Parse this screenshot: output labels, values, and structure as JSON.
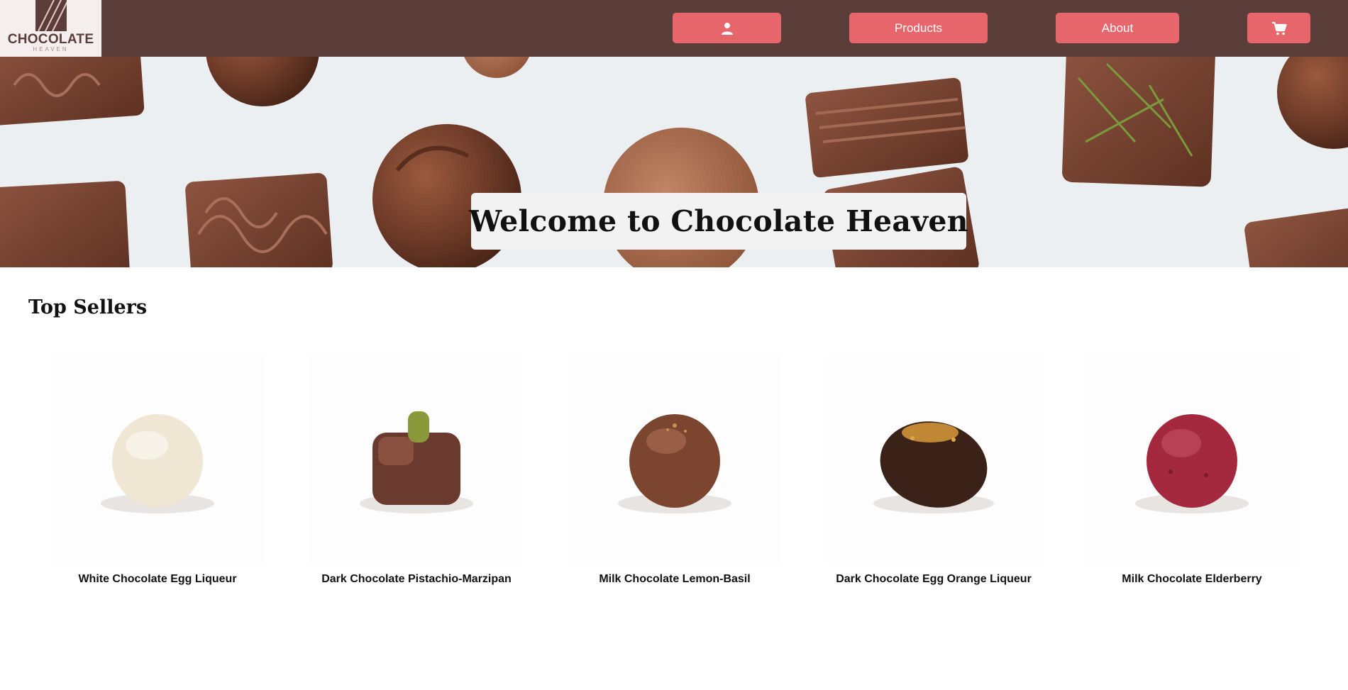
{
  "header": {
    "logo": {
      "main": "CHOCOLATE",
      "sub": "HEAVEN"
    },
    "nav": {
      "account_icon": "person-icon",
      "products_label": "Products",
      "about_label": "About",
      "cart_icon": "shopping-cart-icon"
    },
    "colors": {
      "bar": "#5b3d3a",
      "button": "#e6666b"
    }
  },
  "hero": {
    "title": "Welcome to Chocolate Heaven"
  },
  "top_sellers": {
    "title": "Top Sellers",
    "products": [
      {
        "name": "White Chocolate Egg Liqueur",
        "color": "#efe6d3"
      },
      {
        "name": "Dark Chocolate Pistachio-Marzipan",
        "color": "#6a3a2e"
      },
      {
        "name": "Milk Chocolate Lemon-Basil",
        "color": "#7b4530"
      },
      {
        "name": "Dark Chocolate Egg Orange Liqueur",
        "color": "#3a2218"
      },
      {
        "name": "Milk Chocolate Elderberry",
        "color": "#a4283e"
      }
    ]
  }
}
